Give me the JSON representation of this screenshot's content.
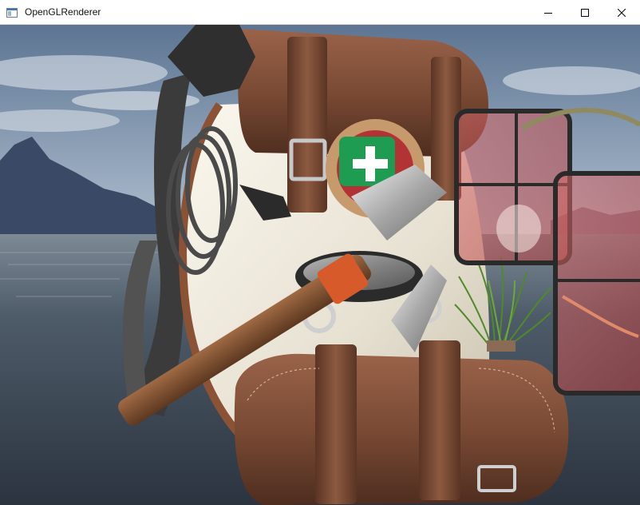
{
  "window": {
    "title": "OpenGLRenderer",
    "icons": {
      "app": "app-window-icon",
      "minimize": "minimize-icon",
      "maximize": "maximize-icon",
      "close": "close-icon"
    }
  },
  "scene": {
    "background": "lake-mountain-skybox",
    "objects": [
      "backpack",
      "grass-billboard",
      "red-transparent-window-1",
      "red-transparent-window-2"
    ],
    "colors": {
      "sky_top": "#5f7896",
      "sky_mid": "#aab6c4",
      "water": "#3f4a57",
      "mountain": "#3a4a66",
      "leather": "#7a4a34",
      "canvas": "#e9e4d8",
      "glass_red": "#c84a4a",
      "grass": "#4f8a2a"
    }
  }
}
